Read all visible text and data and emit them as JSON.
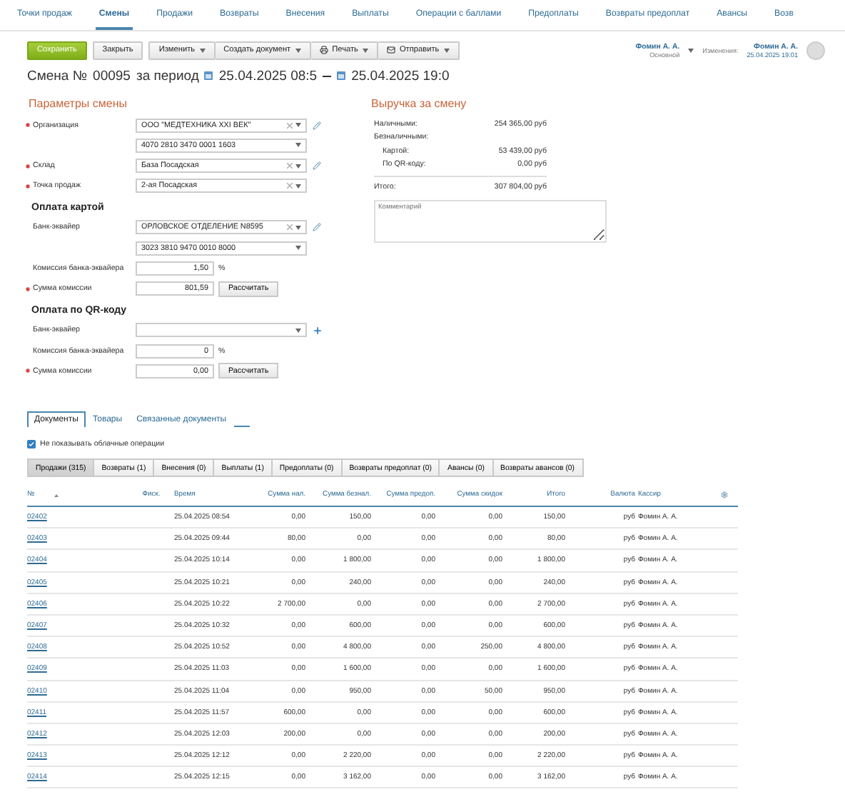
{
  "nav": [
    {
      "label": "Точки продаж",
      "selected": false
    },
    {
      "label": "Смены",
      "selected": true
    },
    {
      "label": "Продажи",
      "selected": false
    },
    {
      "label": "Возвраты",
      "selected": false
    },
    {
      "label": "Внесения",
      "selected": false
    },
    {
      "label": "Выплаты",
      "selected": false
    },
    {
      "label": "Операции с баллами",
      "selected": false
    },
    {
      "label": "Предоплаты",
      "selected": false
    },
    {
      "label": "Возвраты предоплат",
      "selected": false
    },
    {
      "label": "Авансы",
      "selected": false
    },
    {
      "label": "Возв",
      "selected": false
    }
  ],
  "toolbar": [
    {
      "label": "Сохранить",
      "kind": "primary"
    },
    {
      "label": "Закрыть",
      "kind": "plain"
    },
    {
      "label": "Изменить",
      "kind": "dropdown"
    },
    {
      "label": "Создать документ",
      "kind": "dropdown"
    },
    {
      "label": "Печать",
      "kind": "print"
    },
    {
      "label": "Отправить",
      "kind": "send"
    }
  ],
  "user": {
    "name": "Фомин А. А.",
    "role": "Основной"
  },
  "changes": {
    "label": "Изменения:",
    "name": "Фомин А. А.",
    "date": "25.04.2025 19:01"
  },
  "title": {
    "prefix": "Смена №",
    "number": "00095",
    "period": "за период",
    "start": "25.04.2025 08:5",
    "end": "25.04.2025 19:0"
  },
  "params": {
    "heading": "Параметры смены",
    "sections": [
      {
        "rows": [
          {
            "label": "Организация",
            "required": true,
            "kind": "select",
            "value": "ООО \"МЕДТЕХНИКА ХХI ВЕК\"",
            "clearable": true,
            "edit_button": true
          },
          {
            "kind": "select",
            "value": "4070 2810 3470 0001 1603",
            "clearable": false
          },
          {
            "label": "Склад",
            "required": true,
            "kind": "select",
            "value": "База Посадская",
            "clearable": true,
            "edit_button": true
          },
          {
            "label": "Точка продаж",
            "required": true,
            "kind": "select",
            "value": "2-ая Посадская",
            "clearable": true
          }
        ]
      },
      {
        "heading": "Оплата картой",
        "rows": [
          {
            "label": "Банк-эквайер",
            "required": false,
            "kind": "select",
            "value": "ОРЛОВСКОЕ ОТДЕЛЕНИЕ N8595",
            "clearable": true,
            "edit_button": true
          },
          {
            "kind": "select",
            "value": "3023 3810 9470 0010 8000",
            "clearable": false
          },
          {
            "label": "Комиссия банка-эквайера",
            "required": false,
            "kind": "percent",
            "value": "1,50",
            "unit": "%"
          },
          {
            "label": "Сумма комиссии",
            "required": true,
            "kind": "amount",
            "value": "801,59",
            "button": "Рассчитать"
          }
        ]
      },
      {
        "heading": "Оплата по QR-коду",
        "rows": [
          {
            "label": "Банк-эквайер",
            "required": false,
            "kind": "select",
            "value": "",
            "clearable": false,
            "add_button": true
          },
          {
            "label": "Комиссия банка-эквайера",
            "required": false,
            "kind": "percent",
            "value": "0",
            "unit": "%"
          },
          {
            "label": "Сумма комиссии",
            "required": true,
            "kind": "amount",
            "value": "0,00",
            "button": "Рассчитать"
          }
        ]
      }
    ]
  },
  "revenue": {
    "heading": "Выручка за смену",
    "lines": [
      {
        "label": "Наличными:",
        "value": "254 365,00 руб"
      },
      {
        "label": "Безналичными:",
        "children": [
          {
            "label": "Картой:",
            "value": "53 439,00 руб"
          },
          {
            "label": "По QR-коду:",
            "value": "0,00 руб"
          }
        ]
      }
    ],
    "total": {
      "label": "Итого:",
      "value": "307 804,00 руб"
    },
    "comment": {
      "placeholder": "Комментарий"
    }
  },
  "doc_tabs": [
    {
      "label": "Документы",
      "selected": true
    },
    {
      "label": "Товары",
      "selected": false
    },
    {
      "label": "Связанные документы",
      "selected": false
    }
  ],
  "hide_cloud": {
    "label": "Не показывать облачные операции",
    "checked": true
  },
  "filters": [
    {
      "label": "Продажи (315)",
      "selected": true
    },
    {
      "label": "Возвраты (1)",
      "selected": false
    },
    {
      "label": "Внесения (0)",
      "selected": false
    },
    {
      "label": "Выплаты (1)",
      "selected": false
    },
    {
      "label": "Предоплаты (0)",
      "selected": false
    },
    {
      "label": "Возвраты предоплат (0)",
      "selected": false
    },
    {
      "label": "Авансы (0)",
      "selected": false
    },
    {
      "label": "Возвраты авансов (0)",
      "selected": false
    }
  ],
  "table": {
    "columns": [
      "№",
      "Фиск.",
      "Время",
      "Сумма нал.",
      "Сумма безнал.",
      "Сумма предоп.",
      "Сумма скидок",
      "Итого",
      "Валюта",
      "Кассир"
    ],
    "rows": [
      [
        "02402",
        "",
        "25.04.2025 08:54",
        "0,00",
        "150,00",
        "0,00",
        "0,00",
        "150,00",
        "руб",
        "Фомин А. А."
      ],
      [
        "02403",
        "",
        "25.04.2025 09:44",
        "80,00",
        "0,00",
        "0,00",
        "0,00",
        "80,00",
        "руб",
        "Фомин А. А."
      ],
      [
        "02404",
        "",
        "25.04.2025 10:14",
        "0,00",
        "1 800,00",
        "0,00",
        "0,00",
        "1 800,00",
        "руб",
        "Фомин А. А."
      ],
      [
        "02405",
        "",
        "25.04.2025 10:21",
        "0,00",
        "240,00",
        "0,00",
        "0,00",
        "240,00",
        "руб",
        "Фомин А. А."
      ],
      [
        "02406",
        "",
        "25.04.2025 10:22",
        "2 700,00",
        "0,00",
        "0,00",
        "0,00",
        "2 700,00",
        "руб",
        "Фомин А. А."
      ],
      [
        "02407",
        "",
        "25.04.2025 10:32",
        "0,00",
        "600,00",
        "0,00",
        "0,00",
        "600,00",
        "руб",
        "Фомин А. А."
      ],
      [
        "02408",
        "",
        "25.04.2025 10:52",
        "0,00",
        "4 800,00",
        "0,00",
        "250,00",
        "4 800,00",
        "руб",
        "Фомин А. А."
      ],
      [
        "02409",
        "",
        "25.04.2025 11:03",
        "0,00",
        "1 600,00",
        "0,00",
        "0,00",
        "1 600,00",
        "руб",
        "Фомин А. А."
      ],
      [
        "02410",
        "",
        "25.04.2025 11:04",
        "0,00",
        "950,00",
        "0,00",
        "50,00",
        "950,00",
        "руб",
        "Фомин А. А."
      ],
      [
        "02411",
        "",
        "25.04.2025 11:57",
        "600,00",
        "0,00",
        "0,00",
        "0,00",
        "600,00",
        "руб",
        "Фомин А. А."
      ],
      [
        "02412",
        "",
        "25.04.2025 12:03",
        "200,00",
        "0,00",
        "0,00",
        "0,00",
        "200,00",
        "руб",
        "Фомин А. А."
      ],
      [
        "02413",
        "",
        "25.04.2025 12:12",
        "0,00",
        "2 220,00",
        "0,00",
        "0,00",
        "2 220,00",
        "руб",
        "Фомин А. А."
      ],
      [
        "02414",
        "",
        "25.04.2025 12:15",
        "0,00",
        "3 162,00",
        "0,00",
        "0,00",
        "3 162,00",
        "руб",
        "Фомин А. А."
      ]
    ]
  }
}
